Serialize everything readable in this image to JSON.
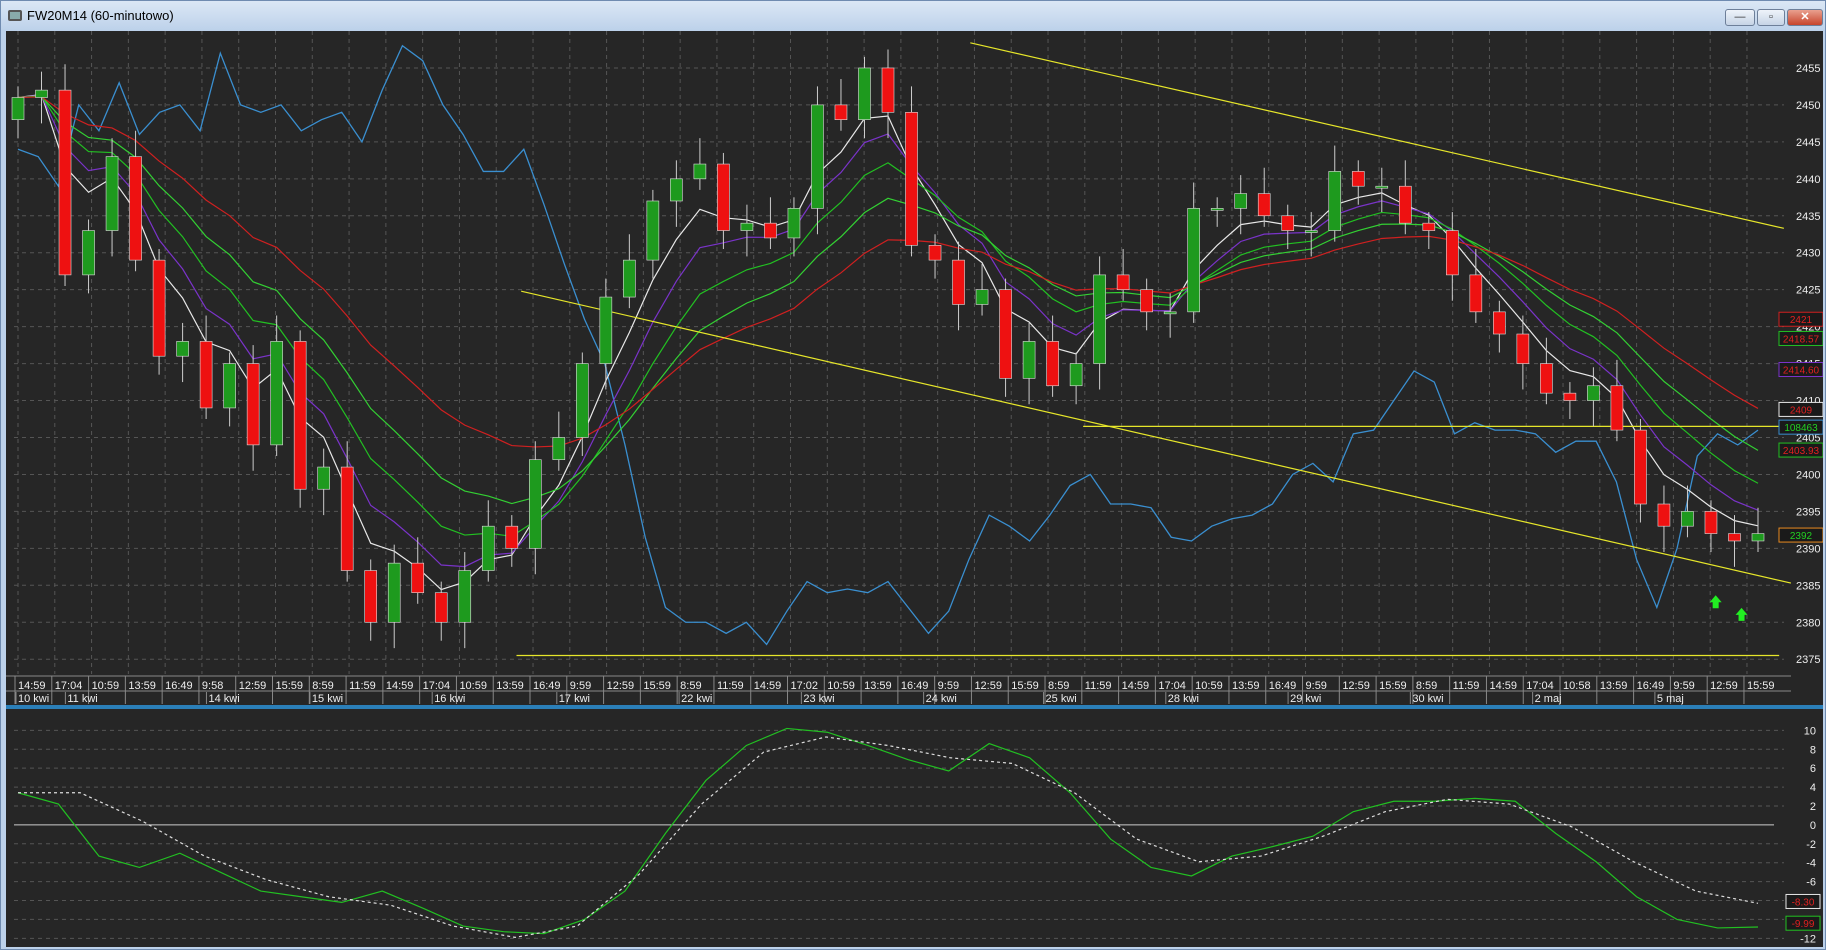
{
  "window": {
    "title": "FW20M14 (60-minutowo)",
    "buttons": {
      "minimize": "—",
      "maximize": "▫",
      "close": "✕"
    }
  },
  "chart_data": [
    {
      "type": "candlestick",
      "title": "FW20M14 (60-minutowo)",
      "ylim": [
        2373,
        2460
      ],
      "yticks": [
        2375,
        2380,
        2385,
        2390,
        2395,
        2400,
        2405,
        2410,
        2415,
        2420,
        2425,
        2430,
        2435,
        2440,
        2445,
        2450,
        2455
      ],
      "first_open": 2448,
      "closes": [
        2451,
        2452,
        2427,
        2433,
        2443,
        2429,
        2416,
        2418,
        2409,
        2415,
        2404,
        2418,
        2398,
        2401,
        2387,
        2380,
        2388,
        2384,
        2380,
        2387,
        2393,
        2390,
        2402,
        2405,
        2415,
        2424,
        2429,
        2437,
        2440,
        2442,
        2433,
        2434,
        2432,
        2436,
        2450,
        2448,
        2455,
        2449,
        2431,
        2429,
        2423,
        2425,
        2413,
        2418,
        2412,
        2415,
        2427,
        2425,
        2422,
        2422,
        2436,
        2436,
        2438,
        2435,
        2433,
        2433,
        2441,
        2439,
        2439,
        2434,
        2433,
        2427,
        2422,
        2419,
        2415,
        2411,
        2410,
        2412,
        2406,
        2396,
        2393,
        2395,
        2392,
        2391,
        2392
      ],
      "time_labels": [
        "14:59",
        "17:04",
        "10:59",
        "13:59",
        "16:49",
        "9:58",
        "12:59",
        "15:59",
        "8:59",
        "11:59",
        "14:59",
        "17:04",
        "10:59",
        "13:59",
        "16:49",
        "9:59",
        "12:59",
        "15:59",
        "8:59",
        "11:59",
        "14:59",
        "17:02",
        "10:59",
        "13:59",
        "16:49",
        "9:59",
        "12:59",
        "15:59",
        "8:59",
        "11:59",
        "14:59",
        "17:04",
        "10:59",
        "13:59",
        "16:49",
        "9:59",
        "12:59",
        "15:59",
        "8:59",
        "11:59",
        "14:59",
        "17:04",
        "10:58",
        "13:59",
        "16:49",
        "9:59",
        "12:59",
        "15:59"
      ],
      "date_labels": [
        {
          "label": "10 kwi",
          "bar": 0
        },
        {
          "label": "11 kwi",
          "bar": 2.1
        },
        {
          "label": "14 kwi",
          "bar": 8.1
        },
        {
          "label": "15 kwi",
          "bar": 12.5
        },
        {
          "label": "16 kwi",
          "bar": 17.7
        },
        {
          "label": "17 kwi",
          "bar": 23
        },
        {
          "label": "22 kwi",
          "bar": 28.2
        },
        {
          "label": "23 kwi",
          "bar": 33.4
        },
        {
          "label": "24 kwi",
          "bar": 38.6
        },
        {
          "label": "25 kwi",
          "bar": 43.7
        },
        {
          "label": "28 kwi",
          "bar": 48.9
        },
        {
          "label": "29 kwi",
          "bar": 54.1
        },
        {
          "label": "30 kwi",
          "bar": 59.3
        },
        {
          "label": "2 maj",
          "bar": 64.5
        },
        {
          "label": "5 maj",
          "bar": 69.7
        }
      ],
      "moving_averages": [
        {
          "name": "ma-white",
          "color": "#e8e8e8",
          "period": 4
        },
        {
          "name": "ma-purple",
          "color": "#7a33c9",
          "period": 6
        },
        {
          "name": "ma-green",
          "color": "#22c022",
          "period": 9
        },
        {
          "name": "ma-green-2",
          "color": "#33d033",
          "period": 13
        },
        {
          "name": "ma-red",
          "color": "#d02020",
          "period": 20
        }
      ],
      "overlay_line": {
        "name": "open-interest",
        "color": "#3a8fd0",
        "values": [
          2444,
          2443,
          2439,
          2450,
          2446.5,
          2453,
          2446,
          2449,
          2450,
          2446.5,
          2457,
          2450,
          2449,
          2450,
          2446.5,
          2448,
          2449,
          2445,
          2452,
          2458,
          2456,
          2450,
          2446,
          2441,
          2441,
          2444,
          2436.5,
          2428.5,
          2421,
          2415,
          2404,
          2391.5,
          2382,
          2380,
          2380,
          2378.5,
          2380,
          2377,
          2381.5,
          2385.5,
          2384,
          2384.5,
          2384,
          2385.5,
          2382,
          2378.5,
          2381.5,
          2388.5,
          2394.5,
          2393,
          2391,
          2394.5,
          2398.5,
          2400,
          2396,
          2396,
          2395.5,
          2391.5,
          2391,
          2393,
          2394,
          2394.5,
          2396,
          2400,
          2401.5,
          2399,
          2405.5,
          2406,
          2410,
          2414,
          2412.5,
          2405.5,
          2407,
          2406,
          2406,
          2405.5,
          2403,
          2404.5,
          2404.5,
          2399,
          2388.5,
          2382,
          2390,
          2402.5,
          2405.5,
          2404,
          2406
        ]
      },
      "trend_lines": [
        {
          "from": [
            40.5,
            2458.4
          ],
          "to": [
            75.1,
            2433.3
          ]
        },
        {
          "from": [
            21.4,
            2424.8
          ],
          "to": [
            75.4,
            2385.3
          ]
        },
        {
          "from": [
            45.3,
            2406.5
          ],
          "to": [
            74.9,
            2406.5
          ]
        },
        {
          "from": [
            21.2,
            2375.5
          ],
          "to": [
            74.9,
            2375.5
          ]
        }
      ],
      "signal_arrows": [
        {
          "bar": 72.2,
          "price": 2382.7
        },
        {
          "bar": 73.3,
          "price": 2381
        }
      ],
      "value_labels": [
        {
          "text": "2421",
          "price": 2421,
          "border": "#d02020",
          "color": "#e02020"
        },
        {
          "text": "2418.57",
          "price": 2418.4,
          "border": "#22c022",
          "color": "#e02020"
        },
        {
          "text": "2414.60",
          "price": 2414.2,
          "border": "#7a33c9",
          "color": "#e02020"
        },
        {
          "text": "2409",
          "price": 2408.8,
          "border": "#e8e8e8",
          "color": "#e02020"
        },
        {
          "text": "108463",
          "price": 2406.4,
          "border": "#3a8fd0",
          "color": "#22d022"
        },
        {
          "text": "2403.93",
          "price": 2403.3,
          "border": "#22c022",
          "color": "#e02020"
        },
        {
          "text": "2392",
          "price": 2391.8,
          "border": "#e88a20",
          "color": "#22d022"
        }
      ]
    },
    {
      "type": "line",
      "title": "oscillator",
      "ylim": [
        -12.6,
        11.2
      ],
      "yticks": [
        10,
        8,
        6,
        4,
        2,
        0,
        -2,
        -4,
        -6,
        -8,
        -10,
        -12
      ],
      "series": [
        {
          "name": "oscillator",
          "color": "#22c022",
          "dashed": false,
          "values": [
            3.4,
            2.2,
            -3.3,
            -4.5,
            -3,
            -5,
            -7,
            -7.6,
            -8.2,
            -7,
            -8.8,
            -10.7,
            -11.3,
            -11.5,
            -10,
            -7,
            -0.9,
            4.7,
            8.4,
            10.2,
            9.8,
            8.4,
            6.9,
            5.7,
            8.6,
            7.1,
            3.4,
            -1.5,
            -4.5,
            -5.4,
            -3.3,
            -2.3,
            -1.2,
            1.4,
            2.5,
            2.5,
            2.8,
            2.5,
            -0.9,
            -3.9,
            -7.6,
            -10,
            -10.9,
            -10.8
          ]
        },
        {
          "name": "signal",
          "color": "#dddddd",
          "dashed": true,
          "values": [
            3.4,
            3.4,
            0.4,
            -3.3,
            -5.8,
            -7.6,
            -8.5,
            -10.7,
            -11.9,
            -10.7,
            -5.2,
            2.2,
            7.7,
            9.3,
            8.4,
            7.1,
            6.5,
            3.4,
            -1.5,
            -3.9,
            -3.3,
            -1.2,
            1.4,
            2.7,
            2.2,
            -0.2,
            -3.9,
            -7,
            -8.3
          ]
        }
      ],
      "value_labels": [
        {
          "text": "-8.30",
          "value": -8.1,
          "border": "#e8e8e8",
          "color": "#e02020"
        },
        {
          "text": "-9.99",
          "value": -10.4,
          "border": "#22c022",
          "color": "#e02020"
        }
      ]
    }
  ]
}
